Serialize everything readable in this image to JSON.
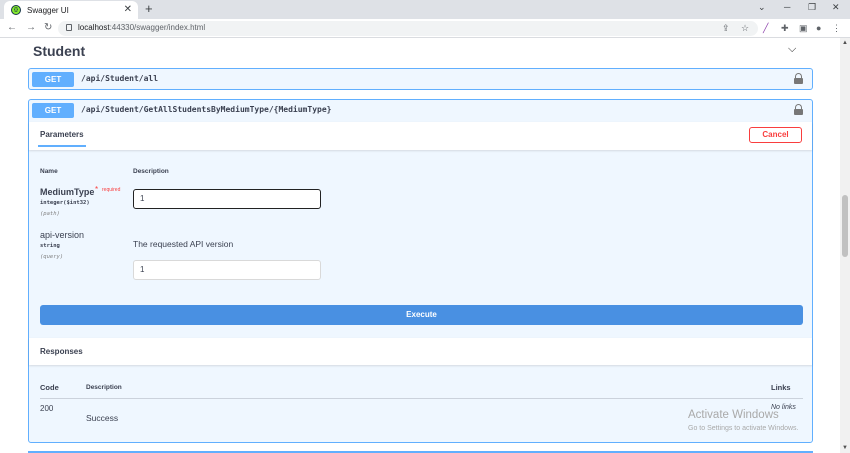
{
  "browser": {
    "tab_title": "Swagger UI",
    "url_host": "localhost",
    "url_rest": ":44330/swagger/index.html"
  },
  "section": {
    "title": "Student"
  },
  "endpoints": [
    {
      "method": "GET",
      "path": "/api/Student/all"
    },
    {
      "method": "GET",
      "path": "/api/Student/GetAllStudentsByMediumType/{MediumType}"
    }
  ],
  "params_panel": {
    "tab_label": "Parameters",
    "cancel_label": "Cancel",
    "col_name": "Name",
    "col_description": "Description",
    "params": [
      {
        "name": "MediumType",
        "required_mark": "*",
        "required_label": "required",
        "type": "integer($int32)",
        "in": "(path)",
        "value": "1",
        "description": ""
      },
      {
        "name": "api-version",
        "type": "string",
        "in": "(query)",
        "value": "1",
        "description": "The requested API version"
      }
    ],
    "execute_label": "Execute"
  },
  "responses": {
    "title": "Responses",
    "col_code": "Code",
    "col_description": "Description",
    "col_links": "Links",
    "rows": [
      {
        "code": "200",
        "description": "Success",
        "links": "No links"
      }
    ]
  },
  "watermark": {
    "line1": "Activate Windows",
    "line2": "Go to Settings to activate Windows."
  },
  "colors": {
    "get": "#61affe",
    "cancel": "#f93e3e",
    "execute": "#4990e2"
  }
}
